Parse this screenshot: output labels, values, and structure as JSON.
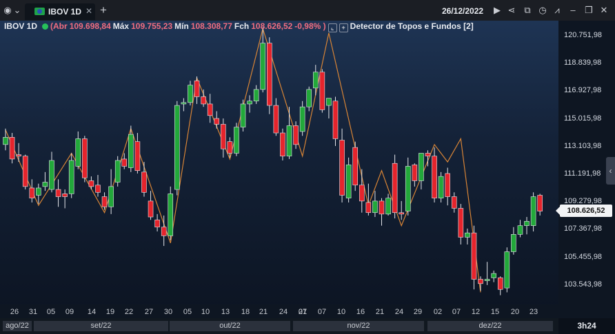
{
  "tab": {
    "title": "IBOV 1D"
  },
  "header": {
    "date": "26/12/2022"
  },
  "info_bar": {
    "symbol": "IBOV 1D",
    "open_label": "(Abr",
    "open": "109.698,84",
    "high_label": "Máx",
    "high": "109.755,23",
    "low_label": "Mín",
    "low": "108.308,77",
    "close_label": "Fch",
    "close": "108.626,52",
    "change": "-0,98% )",
    "indicator": "Detector de Topos e Fundos [2]"
  },
  "price_axis": [
    "120.751,98",
    "118.839,98",
    "116.927,98",
    "115.015,98",
    "113.103,98",
    "111.191,98",
    "109.279,98",
    "107.367,98",
    "105.455,98",
    "103.543,98"
  ],
  "last_price": "108.626,52",
  "x_ticks": [
    "26",
    "31",
    "05",
    "09",
    "14",
    "19",
    "22",
    "27",
    "30",
    "05",
    "10",
    "13",
    "18",
    "21",
    "24",
    "27",
    "01",
    "07",
    "10",
    "16",
    "21",
    "24",
    "29",
    "02",
    "07",
    "12",
    "15",
    "20",
    "23"
  ],
  "months": [
    "ago/22",
    "set/22",
    "out/22",
    "nov/22",
    "dez/22"
  ],
  "timer": "3h24",
  "colors": {
    "up": "#22a83a",
    "down": "#e5242c",
    "zigzag": "#d98536"
  },
  "chart_data": {
    "type": "candlestick",
    "series": [
      {
        "o": 113.2,
        "h": 114.3,
        "l": 112.8,
        "c": 113.7
      },
      {
        "o": 113.7,
        "h": 114.0,
        "l": 111.9,
        "c": 112.2
      },
      {
        "o": 112.5,
        "h": 113.3,
        "l": 112.0,
        "c": 112.4
      },
      {
        "o": 112.4,
        "h": 112.5,
        "l": 110.1,
        "c": 110.3
      },
      {
        "o": 110.2,
        "h": 110.8,
        "l": 109.2,
        "c": 109.5
      },
      {
        "o": 109.7,
        "h": 110.5,
        "l": 109.1,
        "c": 110.2
      },
      {
        "o": 110.3,
        "h": 111.3,
        "l": 110.0,
        "c": 110.6
      },
      {
        "o": 110.1,
        "h": 112.7,
        "l": 109.9,
        "c": 112.1
      },
      {
        "o": 110.1,
        "h": 110.8,
        "l": 108.9,
        "c": 109.6
      },
      {
        "o": 109.8,
        "h": 110.1,
        "l": 108.8,
        "c": 109.6
      },
      {
        "o": 109.8,
        "h": 112.6,
        "l": 109.5,
        "c": 112.1
      },
      {
        "o": 111.7,
        "h": 114.1,
        "l": 111.5,
        "c": 113.6
      },
      {
        "o": 113.6,
        "h": 113.8,
        "l": 110.6,
        "c": 110.9
      },
      {
        "o": 110.7,
        "h": 111.0,
        "l": 110.1,
        "c": 110.3
      },
      {
        "o": 110.4,
        "h": 111.1,
        "l": 109.6,
        "c": 109.9
      },
      {
        "o": 109.6,
        "h": 109.9,
        "l": 108.7,
        "c": 108.9
      },
      {
        "o": 108.9,
        "h": 111.5,
        "l": 108.4,
        "c": 110.3
      },
      {
        "o": 110.6,
        "h": 112.4,
        "l": 110.3,
        "c": 112.1
      },
      {
        "o": 112.2,
        "h": 112.6,
        "l": 111.5,
        "c": 111.7
      },
      {
        "o": 111.6,
        "h": 114.5,
        "l": 111.3,
        "c": 113.9
      },
      {
        "o": 113.4,
        "h": 114.0,
        "l": 111.2,
        "c": 111.4
      },
      {
        "o": 111.3,
        "h": 112.0,
        "l": 109.6,
        "c": 109.9
      },
      {
        "o": 109.3,
        "h": 110.0,
        "l": 108.0,
        "c": 108.2
      },
      {
        "o": 108.0,
        "h": 108.4,
        "l": 107.2,
        "c": 107.5
      },
      {
        "o": 107.5,
        "h": 108.3,
        "l": 106.2,
        "c": 106.9
      },
      {
        "o": 106.9,
        "h": 110.3,
        "l": 106.6,
        "c": 109.8
      },
      {
        "o": 110.1,
        "h": 116.2,
        "l": 109.7,
        "c": 115.9
      },
      {
        "o": 116.0,
        "h": 116.4,
        "l": 115.5,
        "c": 116.1
      },
      {
        "o": 116.1,
        "h": 117.6,
        "l": 115.9,
        "c": 117.3
      },
      {
        "o": 117.6,
        "h": 117.9,
        "l": 116.0,
        "c": 116.5
      },
      {
        "o": 116.5,
        "h": 117.0,
        "l": 115.8,
        "c": 116.0
      },
      {
        "o": 116.0,
        "h": 116.7,
        "l": 114.7,
        "c": 115.2
      },
      {
        "o": 115.0,
        "h": 115.5,
        "l": 114.3,
        "c": 114.6
      },
      {
        "o": 114.6,
        "h": 115.0,
        "l": 112.3,
        "c": 112.9
      },
      {
        "o": 113.4,
        "h": 113.7,
        "l": 112.3,
        "c": 112.6
      },
      {
        "o": 112.6,
        "h": 114.7,
        "l": 112.4,
        "c": 114.4
      },
      {
        "o": 114.4,
        "h": 116.3,
        "l": 114.1,
        "c": 116.0
      },
      {
        "o": 116.0,
        "h": 116.6,
        "l": 115.4,
        "c": 116.2
      },
      {
        "o": 116.2,
        "h": 117.3,
        "l": 116.0,
        "c": 117.0
      },
      {
        "o": 117.0,
        "h": 121.3,
        "l": 116.8,
        "c": 120.2
      },
      {
        "o": 120.2,
        "h": 120.6,
        "l": 115.3,
        "c": 115.9
      },
      {
        "o": 115.9,
        "h": 116.4,
        "l": 113.8,
        "c": 114.0
      },
      {
        "o": 114.0,
        "h": 114.3,
        "l": 112.1,
        "c": 112.4
      },
      {
        "o": 112.4,
        "h": 115.8,
        "l": 112.2,
        "c": 114.5
      },
      {
        "o": 114.5,
        "h": 114.8,
        "l": 112.9,
        "c": 113.2
      },
      {
        "o": 114.1,
        "h": 116.2,
        "l": 113.8,
        "c": 115.8
      },
      {
        "o": 115.8,
        "h": 117.2,
        "l": 115.5,
        "c": 117.0
      },
      {
        "o": 117.1,
        "h": 118.7,
        "l": 116.6,
        "c": 118.2
      },
      {
        "o": 118.2,
        "h": 118.4,
        "l": 115.4,
        "c": 115.6
      },
      {
        "o": 115.9,
        "h": 116.2,
        "l": 115.0,
        "c": 116.4
      },
      {
        "o": 116.2,
        "h": 116.5,
        "l": 113.1,
        "c": 113.6
      },
      {
        "o": 113.5,
        "h": 114.3,
        "l": 109.2,
        "c": 109.7
      },
      {
        "o": 109.5,
        "h": 112.3,
        "l": 109.2,
        "c": 111.8
      },
      {
        "o": 113.0,
        "h": 113.4,
        "l": 110.0,
        "c": 110.4
      },
      {
        "o": 110.4,
        "h": 111.5,
        "l": 108.5,
        "c": 109.3
      },
      {
        "o": 109.2,
        "h": 110.5,
        "l": 108.3,
        "c": 108.5
      },
      {
        "o": 108.5,
        "h": 110.0,
        "l": 108.2,
        "c": 109.3
      },
      {
        "o": 109.3,
        "h": 109.5,
        "l": 107.6,
        "c": 108.4
      },
      {
        "o": 108.4,
        "h": 109.8,
        "l": 108.3,
        "c": 109.5
      },
      {
        "o": 111.9,
        "h": 112.5,
        "l": 108.1,
        "c": 108.5
      },
      {
        "o": 108.5,
        "h": 109.3,
        "l": 108.0,
        "c": 108.4
      },
      {
        "o": 108.6,
        "h": 112.3,
        "l": 108.3,
        "c": 111.7
      },
      {
        "o": 111.8,
        "h": 111.9,
        "l": 110.3,
        "c": 110.7
      },
      {
        "o": 110.7,
        "h": 111.4,
        "l": 110.1,
        "c": 112.6
      },
      {
        "o": 112.6,
        "h": 112.8,
        "l": 111.7,
        "c": 112.4
      },
      {
        "o": 112.4,
        "h": 113.0,
        "l": 109.2,
        "c": 109.5
      },
      {
        "o": 109.5,
        "h": 111.3,
        "l": 109.2,
        "c": 111.0
      },
      {
        "o": 111.2,
        "h": 111.6,
        "l": 109.0,
        "c": 109.6
      },
      {
        "o": 109.6,
        "h": 109.9,
        "l": 108.5,
        "c": 108.8
      },
      {
        "o": 108.8,
        "h": 109.1,
        "l": 106.3,
        "c": 106.8
      },
      {
        "o": 106.8,
        "h": 107.4,
        "l": 106.3,
        "c": 107.1
      },
      {
        "o": 107.1,
        "h": 107.6,
        "l": 103.2,
        "c": 103.9
      },
      {
        "o": 103.9,
        "h": 104.1,
        "l": 103.1,
        "c": 103.6
      },
      {
        "o": 103.8,
        "h": 105.1,
        "l": 103.5,
        "c": 103.9
      },
      {
        "o": 104.0,
        "h": 104.5,
        "l": 103.7,
        "c": 104.3
      },
      {
        "o": 104.0,
        "h": 104.1,
        "l": 102.8,
        "c": 103.2
      },
      {
        "o": 103.3,
        "h": 106.1,
        "l": 103.0,
        "c": 105.8
      },
      {
        "o": 105.8,
        "h": 107.5,
        "l": 105.6,
        "c": 107.0
      },
      {
        "o": 107.0,
        "h": 108.0,
        "l": 106.8,
        "c": 107.6
      },
      {
        "o": 107.6,
        "h": 108.2,
        "l": 107.0,
        "c": 107.9
      },
      {
        "o": 107.6,
        "h": 109.9,
        "l": 107.2,
        "c": 109.6
      },
      {
        "o": 109.7,
        "h": 109.8,
        "l": 108.3,
        "c": 108.6
      }
    ],
    "zigzag": [
      [
        0,
        114.2
      ],
      [
        5,
        109.0
      ],
      [
        10,
        112.6
      ],
      [
        15,
        108.5
      ],
      [
        19,
        114.3
      ],
      [
        25,
        106.4
      ],
      [
        29,
        117.8
      ],
      [
        34,
        112.2
      ],
      [
        39,
        121.2
      ],
      [
        45,
        112.4
      ],
      [
        49,
        120.9
      ],
      [
        55,
        109.0
      ],
      [
        57,
        111.4
      ],
      [
        60,
        107.6
      ],
      [
        65,
        113.2
      ],
      [
        67,
        112.0
      ],
      [
        69,
        113.6
      ],
      [
        72,
        103.0
      ]
    ]
  }
}
